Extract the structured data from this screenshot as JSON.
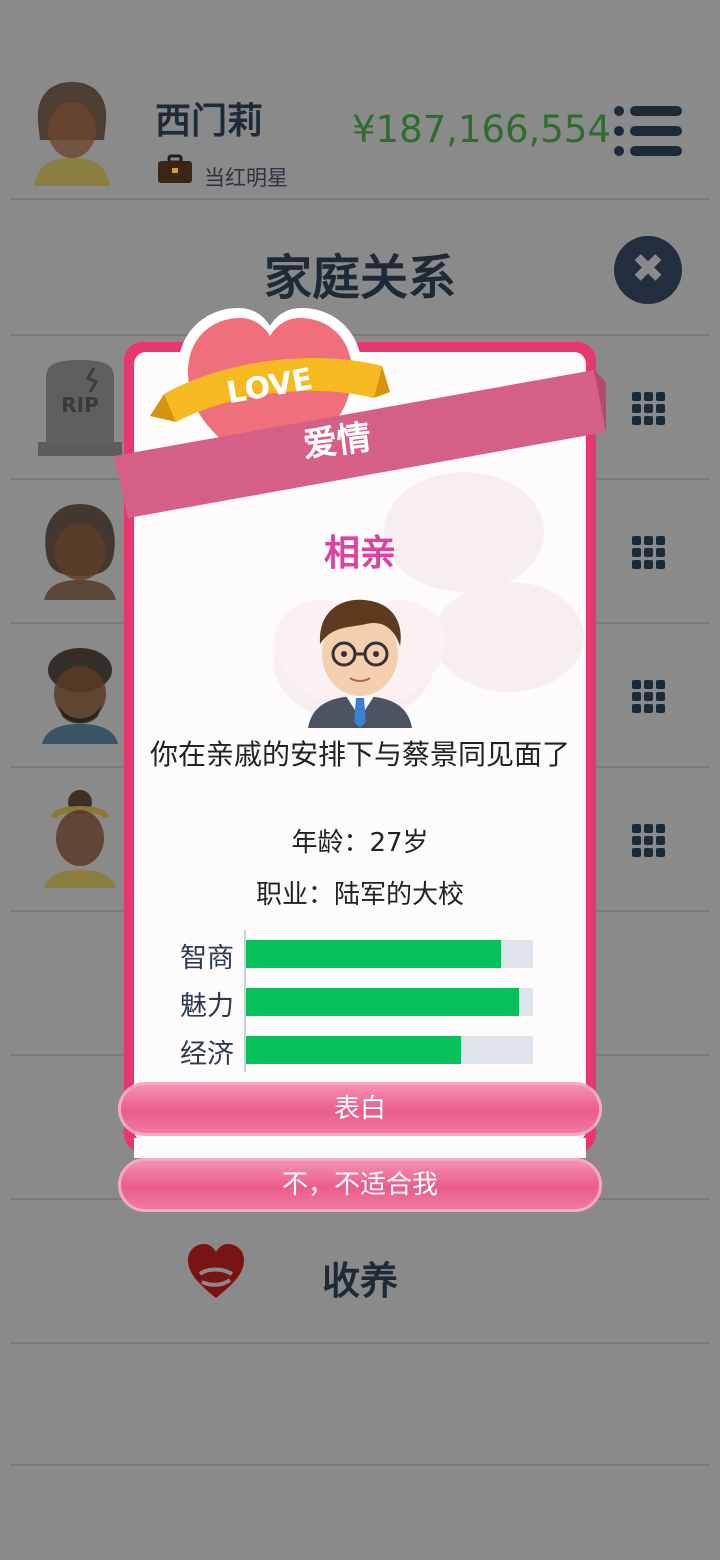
{
  "header": {
    "player_name": "西门莉",
    "job_title": "当红明星",
    "money": "¥187,166,554"
  },
  "page": {
    "title": "家庭关系",
    "close_symbol": "✖",
    "rows": [
      {
        "avatar": "rip-tombstone",
        "tombstone_text": "RIP"
      },
      {
        "avatar": "woman-avatar"
      },
      {
        "avatar": "bearded-man-avatar"
      },
      {
        "avatar": "woman-with-headband-avatar"
      }
    ],
    "adopt_label": "收养"
  },
  "modal": {
    "love_badge_text": "LOVE",
    "banner_title": "爱情",
    "subtitle": "相亲",
    "description": "你在亲戚的安排下与蔡景同见面了",
    "age": "年龄：27岁",
    "occupation": "职业：陆军的大校",
    "stats": [
      {
        "label": "智商",
        "value": 0.89
      },
      {
        "label": "魅力",
        "value": 0.95
      },
      {
        "label": "经济",
        "value": 0.75
      }
    ],
    "confess_button": "表白",
    "reject_button": "不，不适合我"
  },
  "colors": {
    "money": "#2f6d2f",
    "modal_frame": "#e8376c",
    "subtitle": "#e040a0",
    "stat_bar": "#06c05a",
    "button": "#ea5b8e"
  }
}
